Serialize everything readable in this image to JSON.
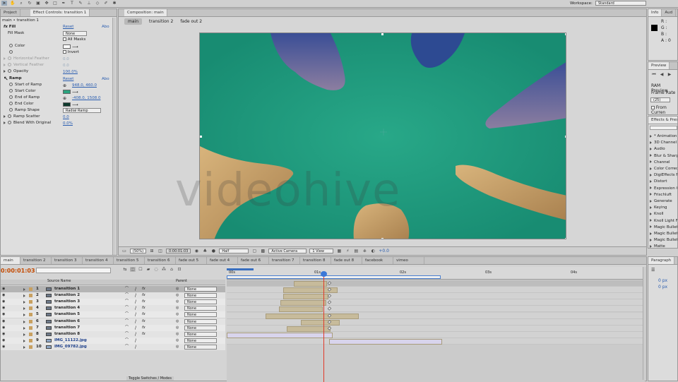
{
  "app": {
    "workspace_label": "Workspace:",
    "workspace_value": "Standard"
  },
  "left_panel": {
    "tabs": [
      "Project",
      "Effect Controls: transition 1"
    ],
    "breadcrumb": "main • transition 1",
    "fx_name": "Fill",
    "reset": "Reset",
    "about": "Abo",
    "rows": [
      {
        "label": "Fill Mask",
        "value": "None"
      },
      {
        "label": "",
        "value": "All Masks"
      },
      {
        "label": "Color",
        "value": ""
      },
      {
        "label": "",
        "value": "Invert"
      },
      {
        "label": "Horizontal Feather",
        "value": "0.0"
      },
      {
        "label": "Vertical Feather",
        "value": "0.0"
      },
      {
        "label": "Opacity",
        "value": "100.0%"
      }
    ],
    "ramp_name": "Ramp",
    "ramp_reset": "Reset",
    "ramp_about": "Abo",
    "ramp_rows": [
      {
        "label": "Start of Ramp",
        "value": "948.0, 460.0"
      },
      {
        "label": "Start Color",
        "value": ""
      },
      {
        "label": "End of Ramp",
        "value": "-408.0, 1508.0"
      },
      {
        "label": "End Color",
        "value": ""
      },
      {
        "label": "Ramp Shape",
        "value": "Radial Ramp"
      },
      {
        "label": "Ramp Scatter",
        "value": "0.0"
      },
      {
        "label": "Blend With Original",
        "value": "0.0%"
      }
    ]
  },
  "composition": {
    "tab": "Composition: main",
    "crumbs": [
      "main",
      "transition 2",
      "fade out 2"
    ],
    "watermark": "videohive",
    "footer": {
      "zoom": "(50%)",
      "time": "0:00:01:03",
      "res": "Half",
      "camera": "Active Camera",
      "view": "1 View",
      "offset": "+0.0"
    }
  },
  "info": {
    "tabs": [
      "Info",
      "Aud"
    ],
    "r": "R :",
    "g": "G :",
    "b": "B :",
    "a": "A : 0"
  },
  "preview": {
    "title": "Preview",
    "ram": "RAM Preview",
    "frame_rate": "Frame Rate",
    "fr_value": "(25)",
    "from_current": "From Curren"
  },
  "effects": {
    "title": "Effects & Pres",
    "items": [
      "* Animation",
      "3D Channel",
      "Audio",
      "Blur & Sharp",
      "Channel",
      "Color Correc",
      "DigiEffects F",
      "Distort",
      "Expression C",
      "Frischluft",
      "Generate",
      "Keying",
      "Knoll",
      "Knoll Light F",
      "Magic Bullet",
      "Magic Bullet",
      "Magic Bullet",
      "Matte"
    ]
  },
  "paragraph": {
    "title": "Paragraph",
    "v1": "0 px",
    "v2": "0 px"
  },
  "timeline": {
    "tabs": [
      "main",
      "transition 2",
      "transition 3",
      "transition 4",
      "transition 5",
      "transition 6",
      "fade out 5",
      "fade out 4",
      "fade out 6",
      "transition 7",
      "transition 8",
      "fade out 8",
      "facebook",
      "vimeo"
    ],
    "timecode": "0:00:01:03",
    "col_source": "Source Name",
    "col_parent": "Parent",
    "ruler": [
      "00s",
      "01s",
      "02s",
      "03s",
      "04s"
    ],
    "layers": [
      {
        "num": "1",
        "name": "transition 1",
        "parent": "None"
      },
      {
        "num": "2",
        "name": "transition 2",
        "parent": "None"
      },
      {
        "num": "3",
        "name": "transition 3",
        "parent": "None"
      },
      {
        "num": "4",
        "name": "transition 4",
        "parent": "None"
      },
      {
        "num": "5",
        "name": "transition 5",
        "parent": "None"
      },
      {
        "num": "6",
        "name": "transition 6",
        "parent": "None"
      },
      {
        "num": "7",
        "name": "transition 7",
        "parent": "None"
      },
      {
        "num": "8",
        "name": "transition 8",
        "parent": "None"
      },
      {
        "num": "9",
        "name": "IMG_11122.jpg",
        "parent": "None"
      },
      {
        "num": "10",
        "name": "IMG_09782.jpg",
        "parent": "None"
      }
    ],
    "footer": "Toggle Switches / Modes"
  },
  "colors": {
    "teal": "#1f9a7e",
    "sky": "#4a5d9c",
    "sand": "#c7a06a",
    "timecode": "#c44a00"
  }
}
